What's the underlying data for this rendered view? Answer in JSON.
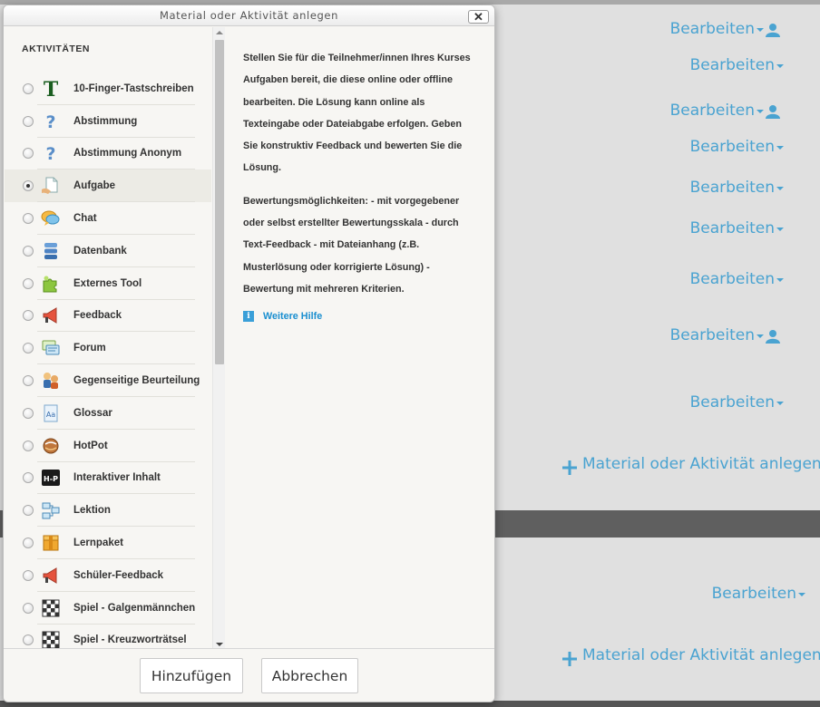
{
  "page": {
    "edit_label": "Bearbeiten",
    "add_activity_label": "Material oder Aktivität anlegen",
    "accent_color": "#4aa3d1"
  },
  "modal": {
    "title": "Material oder Aktivität anlegen",
    "close_glyph": "✕",
    "section_heading": "AKTIVITÄTEN",
    "options": [
      {
        "label": "10-Finger-Tastschreiben",
        "icon": "typewriter-t-icon"
      },
      {
        "label": "Abstimmung",
        "icon": "question-mark-icon"
      },
      {
        "label": "Abstimmung Anonym",
        "icon": "question-mark-icon"
      },
      {
        "label": "Aufgabe",
        "icon": "assignment-icon",
        "selected": true
      },
      {
        "label": "Chat",
        "icon": "chat-bubbles-icon"
      },
      {
        "label": "Datenbank",
        "icon": "database-icon"
      },
      {
        "label": "Externes Tool",
        "icon": "puzzle-icon"
      },
      {
        "label": "Feedback",
        "icon": "megaphone-icon"
      },
      {
        "label": "Forum",
        "icon": "forum-icon"
      },
      {
        "label": "Gegenseitige Beurteilung",
        "icon": "peer-review-icon"
      },
      {
        "label": "Glossar",
        "icon": "glossary-icon"
      },
      {
        "label": "HotPot",
        "icon": "hotpot-icon"
      },
      {
        "label": "Interaktiver Inhalt",
        "icon": "h5p-icon"
      },
      {
        "label": "Lektion",
        "icon": "lesson-icon"
      },
      {
        "label": "Lernpaket",
        "icon": "package-icon"
      },
      {
        "label": "Schüler-Feedback",
        "icon": "megaphone-icon"
      },
      {
        "label": "Spiel - Galgenmännchen",
        "icon": "game-board-icon"
      },
      {
        "label": "Spiel - Kreuzworträtsel",
        "icon": "game-board-icon"
      }
    ],
    "help": {
      "paragraph1": "Stellen Sie für die Teilnehmer/innen Ihres Kurses Aufgaben bereit, die diese online oder offline bearbeiten. Die Lösung kann online als Texteingabe oder Dateiabgabe erfolgen. Geben Sie konstruktiv Feedback und bewerten Sie die Lösung.",
      "paragraph2": "Bewertungsmöglichkeiten: - mit vorgegebener oder selbst erstellter Bewertungsskala - durch Text-Feedback - mit Dateianhang (z.B. Musterlösung oder korrigierte Lösung) - Bewertung mit mehreren Kriterien.",
      "link_label": "Weitere Hilfe",
      "info_glyph": "i"
    },
    "buttons": {
      "add": "Hinzufügen",
      "cancel": "Abbrechen"
    }
  }
}
